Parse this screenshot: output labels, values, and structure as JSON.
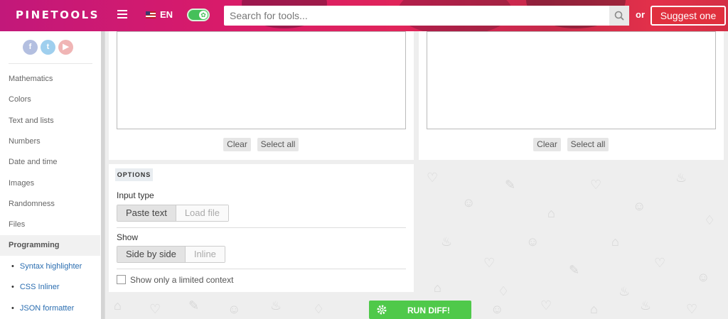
{
  "header": {
    "logo": "PINETOOLS",
    "language": "EN",
    "search_placeholder": "Search for tools...",
    "or_text": "or",
    "suggest_label": "Suggest one"
  },
  "sidebar": {
    "socials": [
      "f",
      "t",
      "▶"
    ],
    "categories": [
      "Mathematics",
      "Colors",
      "Text and lists",
      "Numbers",
      "Date and time",
      "Images",
      "Randomness",
      "Files",
      "Programming"
    ],
    "active_category": "Programming",
    "subitems": [
      "Syntax highlighter",
      "CSS Inliner",
      "JSON formatter"
    ]
  },
  "left_panel": {
    "clear_label": "Clear",
    "select_all_label": "Select all"
  },
  "right_panel": {
    "clear_label": "Clear",
    "select_all_label": "Select all"
  },
  "options": {
    "title": "OPTIONS",
    "input_type_label": "Input type",
    "input_type_options": [
      "Paste text",
      "Load file"
    ],
    "input_type_selected": "Paste text",
    "show_label": "Show",
    "show_options": [
      "Side by side",
      "Inline"
    ],
    "show_selected": "Side by side",
    "limited_context_label": "Show only a limited context",
    "limited_context_checked": false
  },
  "run_label": "RUN DIFF!",
  "colors": {
    "header_gradient_start": "#c2187a",
    "header_gradient_end": "#e3304a",
    "run_button": "#4fc94a",
    "link": "#2a6db0"
  }
}
